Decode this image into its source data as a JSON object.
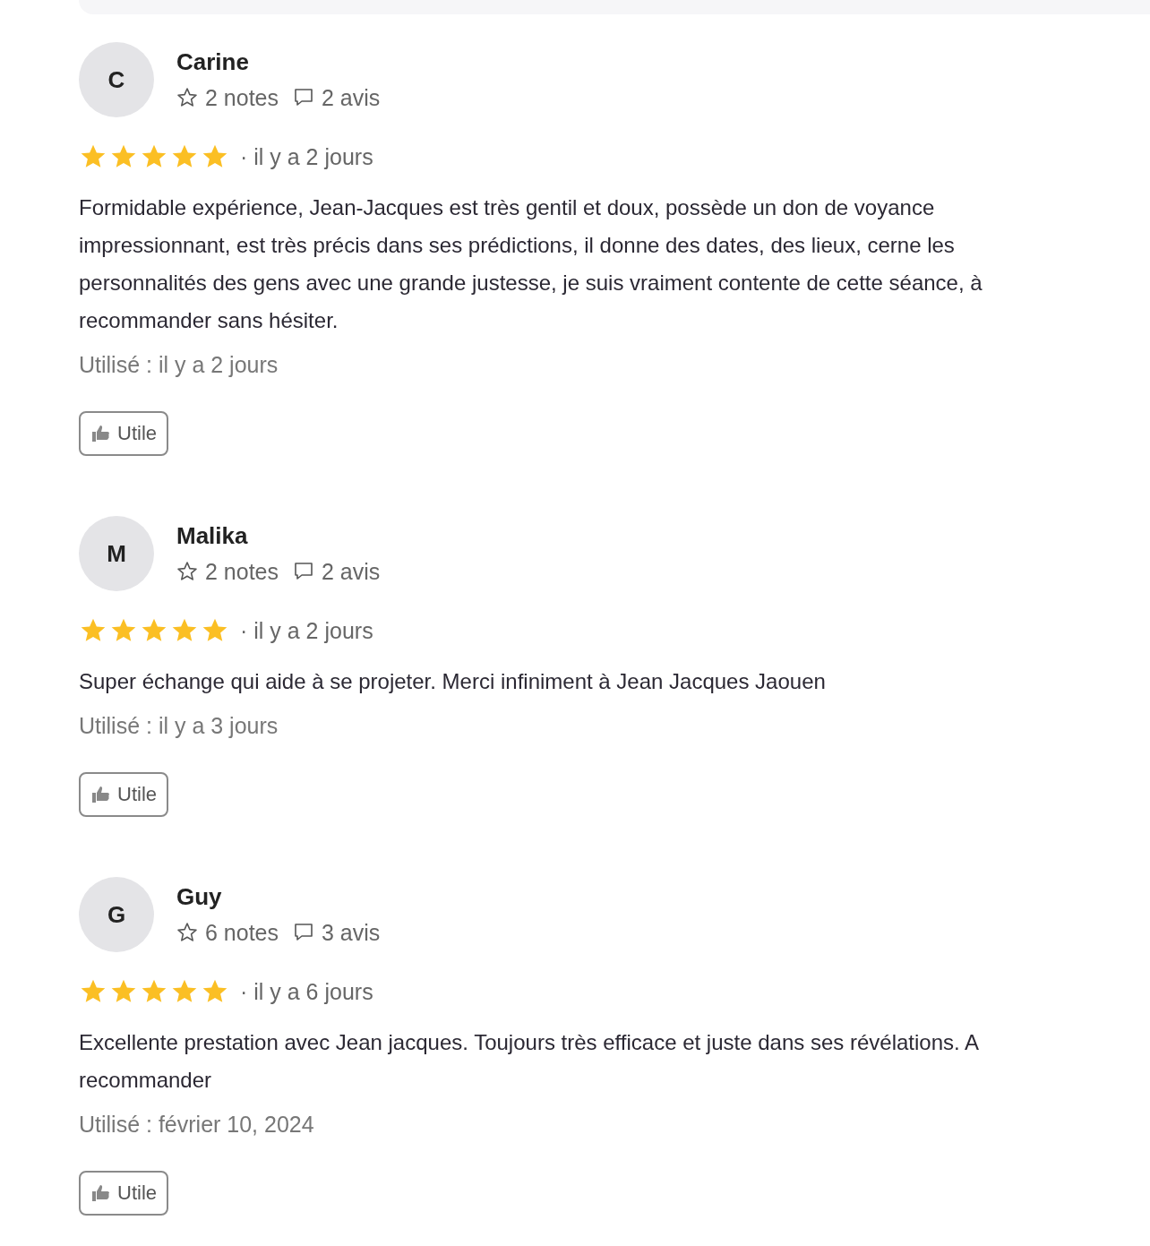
{
  "reviews": [
    {
      "initial": "C",
      "name": "Carine",
      "ratings": "2 notes",
      "comments": "2 avis",
      "stars": 5,
      "date": "· il y a 2 jours",
      "text": "Formidable expérience, Jean-Jacques est très gentil et doux, possède un don de voyance impressionnant, est très précis dans ses prédictions, il donne des dates, des lieux, cerne les personnalités des gens avec une grande justesse, je suis vraiment contente de cette séance, à recommander sans hésiter.",
      "used": "Utilisé : il y a 2 jours",
      "button": "Utile"
    },
    {
      "initial": "M",
      "name": "Malika",
      "ratings": "2 notes",
      "comments": "2 avis",
      "stars": 5,
      "date": "· il y a 2 jours",
      "text": "Super échange qui aide à se projeter. Merci infiniment à Jean Jacques Jaouen",
      "used": "Utilisé : il y a 3 jours",
      "button": "Utile"
    },
    {
      "initial": "G",
      "name": "Guy",
      "ratings": "6 notes",
      "comments": "3 avis",
      "stars": 5,
      "date": "· il y a 6 jours",
      "text": "Excellente prestation avec Jean jacques. Toujours très efficace et juste dans ses révélations. A recommander",
      "used": "Utilisé : février 10, 2024",
      "button": "Utile"
    }
  ]
}
